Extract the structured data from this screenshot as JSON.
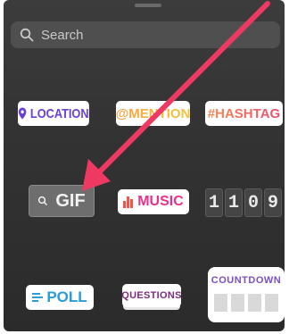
{
  "search": {
    "placeholder": "Search",
    "icon": "search-icon"
  },
  "stickers": {
    "location": {
      "label": "LOCATION",
      "icon": "location-pin-icon",
      "color": "#6b3fd6"
    },
    "mention": {
      "label": "@MENTION"
    },
    "hashtag": {
      "label": "#HASHTAG"
    },
    "gif": {
      "label": "GIF",
      "icon": "search-icon"
    },
    "music": {
      "label": "MUSIC",
      "icon": "music-bars-icon"
    },
    "countdown_clock": {
      "digits": [
        "1",
        "1",
        "0",
        "9"
      ]
    },
    "poll": {
      "label": "POLL",
      "icon": "poll-lines-icon"
    },
    "questions": {
      "label": "QUESTIONS"
    },
    "countdown": {
      "label": "COUNTDOWN"
    }
  },
  "colors": {
    "background": "#333333",
    "arrow": "#ee3a63",
    "search_bg": "#4f4f4f"
  }
}
